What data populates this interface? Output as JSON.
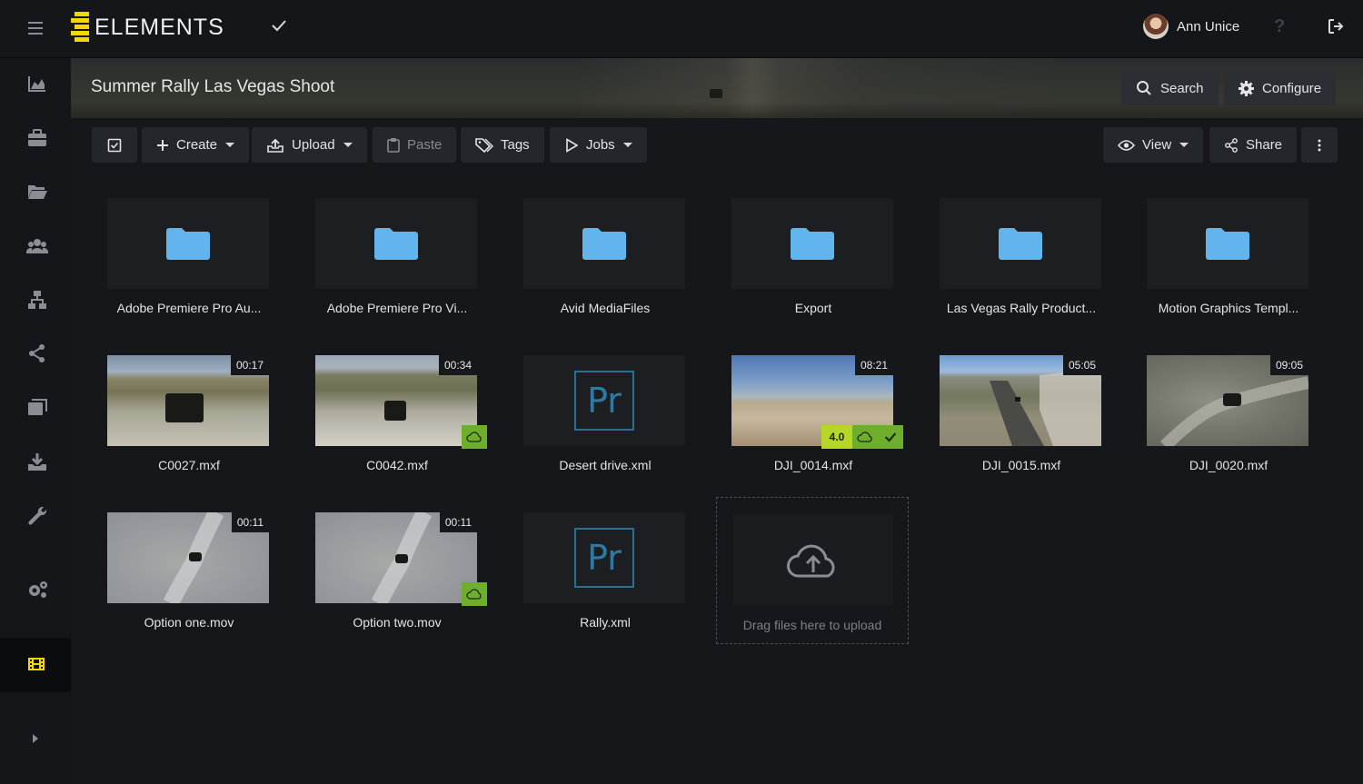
{
  "app": {
    "logo_text": "ELEMENTS",
    "user_name": "Ann Unice",
    "help_label": "?"
  },
  "header": {
    "title": "Summer Rally Las Vegas Shoot",
    "search_label": "Search",
    "configure_label": "Configure"
  },
  "toolbar": {
    "create_label": "Create",
    "upload_label": "Upload",
    "paste_label": "Paste",
    "tags_label": "Tags",
    "jobs_label": "Jobs",
    "view_label": "View",
    "share_label": "Share"
  },
  "folders": [
    {
      "name": "Adobe Premiere Pro Au..."
    },
    {
      "name": "Adobe Premiere Pro Vi..."
    },
    {
      "name": "Avid MediaFiles"
    },
    {
      "name": "Export"
    },
    {
      "name": "Las Vegas Rally Product..."
    },
    {
      "name": "Motion Graphics Templ..."
    }
  ],
  "files_row1": [
    {
      "name": "C0027.mxf",
      "duration": "00:17"
    },
    {
      "name": "C0042.mxf",
      "duration": "00:34"
    },
    {
      "name": "Desert drive.xml",
      "icon": "Pr"
    },
    {
      "name": "DJI_0014.mxf",
      "duration": "08:21",
      "version": "4.0"
    },
    {
      "name": "DJI_0015.mxf",
      "duration": "05:05"
    },
    {
      "name": "DJI_0020.mxf",
      "duration": "09:05"
    }
  ],
  "files_row2": [
    {
      "name": "Option one.mov",
      "duration": "00:11"
    },
    {
      "name": "Option two.mov",
      "duration": "00:11"
    },
    {
      "name": "Rally.xml",
      "icon": "Pr"
    }
  ],
  "upload_zone": {
    "text": "Drag files here to upload"
  },
  "colors": {
    "accent_yellow": "#f5d700",
    "folder_blue": "#62b5ec",
    "badge_green": "#6fae2c",
    "version_green": "#b6d727",
    "premiere_blue": "#2e7aa2"
  }
}
